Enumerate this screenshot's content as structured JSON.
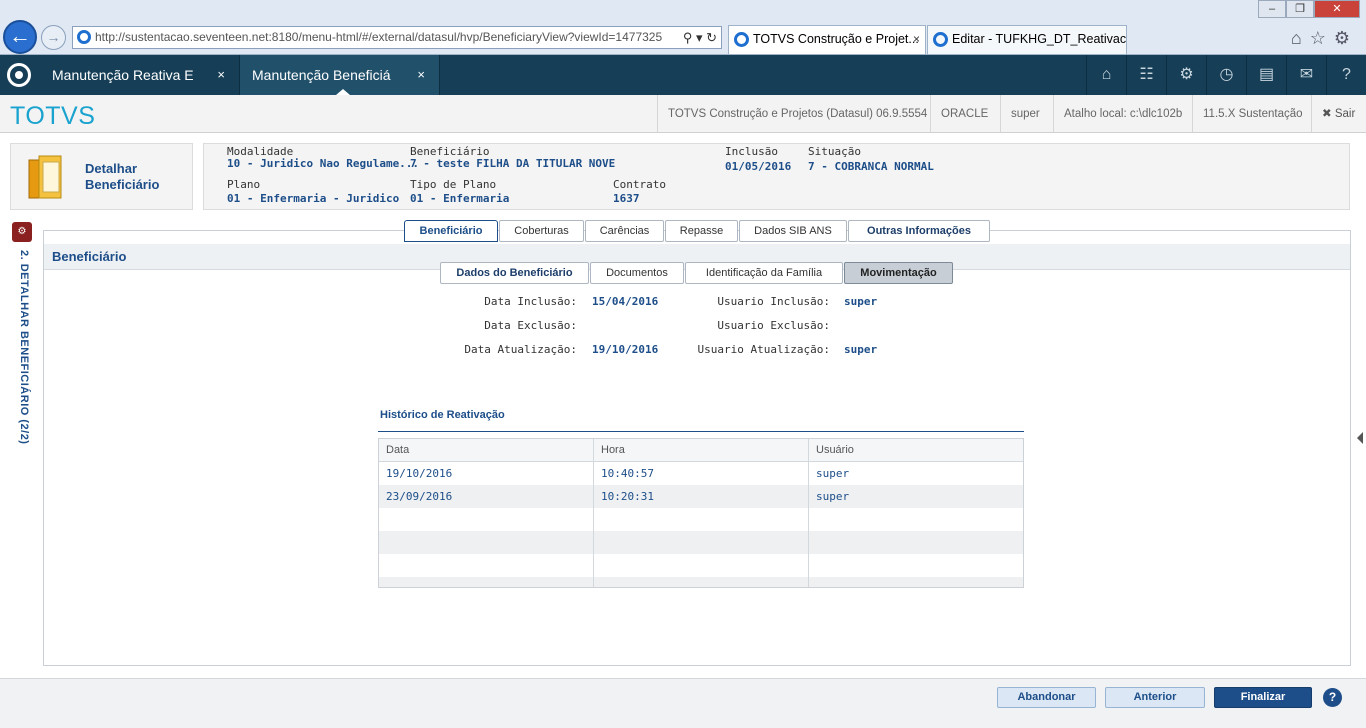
{
  "browser": {
    "url": "http://sustentacao.seventeen.net:8180/menu-html/#/external/datasul/hvp/BeneficiaryView?viewId=1477325",
    "tabs": [
      {
        "label": "TOTVS Construção e Projet..."
      },
      {
        "label": "Editar - TUFKHG_DT_Reativaca..."
      }
    ]
  },
  "app": {
    "tabs": [
      {
        "label": "Manutenção Reativa E"
      },
      {
        "label": "Manutenção Beneficiá"
      }
    ],
    "icons": [
      "home-icon",
      "sitemap-icon",
      "gear-icon",
      "dashboard-icon",
      "document-icon",
      "mail-icon",
      "help-icon"
    ]
  },
  "header": {
    "brand": "TOTVS",
    "items": [
      "TOTVS Construção e Projetos (Datasul) 06.9.5554",
      "ORACLE",
      "super",
      "Atalho local: c:\\dlc102b",
      "11.5.X Sustentação"
    ],
    "logout": "Sair"
  },
  "side": {
    "vertical_label": "2. DETALHAR BENEFICIÁRIO (2/2)"
  },
  "context": {
    "title_line1": "Detalhar",
    "title_line2": "Beneficiário",
    "fields": {
      "modalidade": {
        "label": "Modalidade",
        "value": "10 - Juridico Nao Regulame..."
      },
      "beneficiario": {
        "label": "Beneficiário",
        "value": "7 - teste FILHA DA TITULAR NOVE"
      },
      "inclusao": {
        "label": "Inclusão",
        "value": "01/05/2016"
      },
      "situacao": {
        "label": "Situação",
        "value": "7 - COBRANCA NORMAL"
      },
      "plano": {
        "label": "Plano",
        "value": "01 - Enfermaria - Juridico"
      },
      "tipo_plano": {
        "label": "Tipo de Plano",
        "value": "01 - Enfermaria"
      },
      "contrato": {
        "label": "Contrato",
        "value": "1637"
      }
    }
  },
  "main_tabs": [
    "Beneficiário",
    "Coberturas",
    "Carências",
    "Repasse",
    "Dados SIB ANS",
    "Outras Informações"
  ],
  "panel": {
    "title": "Beneficiário",
    "sub_tabs": [
      "Dados do Beneficiário",
      "Documentos",
      "Identificação da Família",
      "Movimentação"
    ]
  },
  "movimentacao": {
    "data_inclusao": {
      "label": "Data Inclusão:",
      "value": "15/04/2016"
    },
    "data_exclusao": {
      "label": "Data Exclusão:",
      "value": ""
    },
    "data_atualizacao": {
      "label": "Data Atualização:",
      "value": "19/10/2016"
    },
    "usuario_inclusao": {
      "label": "Usuario Inclusão:",
      "value": "super"
    },
    "usuario_exclusao": {
      "label": "Usuario Exclusão:",
      "value": ""
    },
    "usuario_atualizacao": {
      "label": "Usuario Atualização:",
      "value": "super"
    }
  },
  "historico": {
    "title": "Histórico de Reativação",
    "columns": [
      "Data",
      "Hora",
      "Usuário"
    ],
    "rows": [
      [
        "19/10/2016",
        "10:40:57",
        "super"
      ],
      [
        "23/09/2016",
        "10:20:31",
        "super"
      ]
    ]
  },
  "footer": {
    "abandonar": "Abandonar",
    "anterior": "Anterior",
    "finalizar": "Finalizar",
    "help": "?"
  }
}
